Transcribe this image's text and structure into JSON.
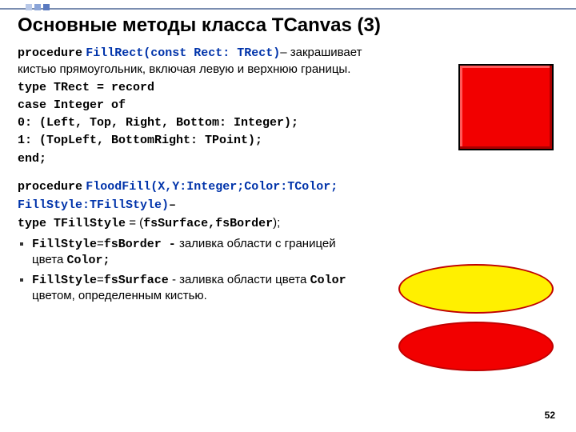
{
  "title": "Основные методы класса TCanvas (3)",
  "proc1": {
    "kw": "procedure",
    "sig": "FillRect(const Rect: TRect)",
    "desc": "– закрашивает кистью прямоугольник, включая левую и верхнюю границы.",
    "line1": "type TRect = record",
    "line2": "case Integer of",
    "line3": "0: (Left, Top, Right, Bottom: Integer);",
    "line4": "1: (TopLeft, BottomRight: TPoint);",
    "line5": "end;"
  },
  "proc2": {
    "kw": "procedure",
    "sig1": "FloodFill(X,Y:Integer;Color:TColor;",
    "sig2": "FillStyle:TFillStyle)",
    "dash": "–",
    "line1a": "type TFillStyle",
    "line1b": " = (",
    "line1c": "fsSurface,fsBorder",
    "line1d": ");"
  },
  "bullets": {
    "b1a": "FillStyle",
    "b1b": "=",
    "b1c": "fsBorder -",
    "b1d": " заливка области с границей цвета ",
    "b1e": "Color;",
    "b2a": "FillStyle",
    "b2b": "=",
    "b2c": "fsSurface",
    "b2d": " - заливка области цвета ",
    "b2e": "Color",
    "b2f": " цветом, определенным кистью."
  },
  "page": "52"
}
